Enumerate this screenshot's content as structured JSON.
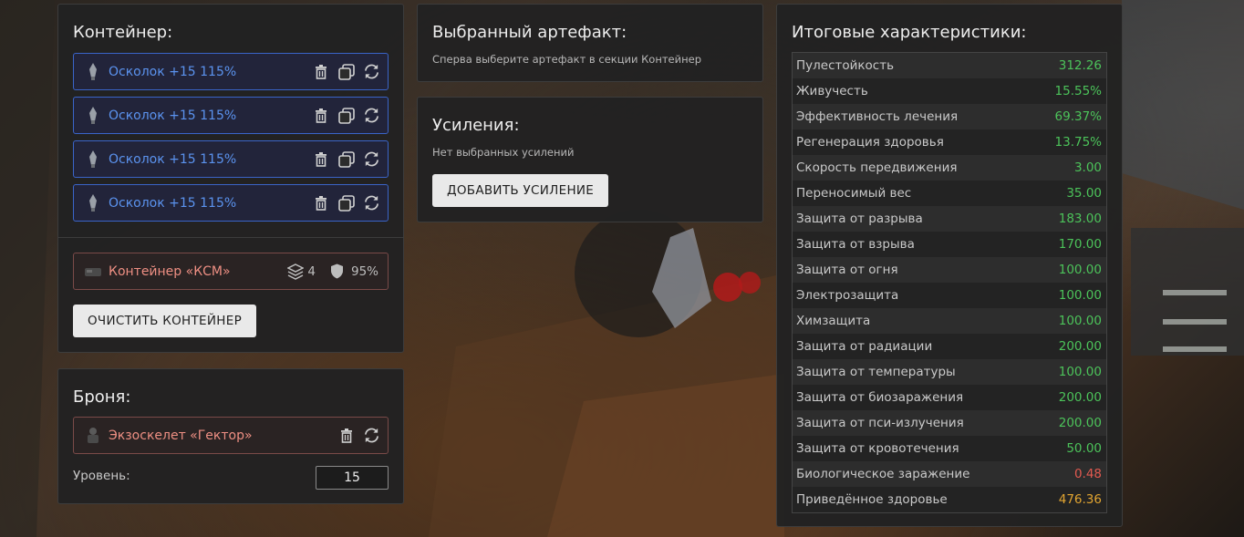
{
  "container_panel": {
    "title": "Контейнер:",
    "artifacts": [
      {
        "label": "Осколок +15 115%"
      },
      {
        "label": "Осколок +15 115%"
      },
      {
        "label": "Осколок +15 115%"
      },
      {
        "label": "Осколок +15 115%"
      }
    ],
    "container": {
      "label": "Контейнер «КСМ»",
      "slots": "4",
      "protection": "95%"
    },
    "clear_button": "ОЧИСТИТЬ КОНТЕЙНЕР"
  },
  "armor_panel": {
    "title": "Броня:",
    "armor": {
      "label": "Экзоскелет «Гектор»"
    },
    "level_label": "Уровень:",
    "level_value": "15"
  },
  "selected_artifact_panel": {
    "title": "Выбранный артефакт:",
    "hint": "Сперва выберите артефакт в секции Контейнер"
  },
  "boosts_panel": {
    "title": "Усиления:",
    "hint": "Нет выбранных усилений",
    "add_button": "ДОБАВИТЬ УСИЛЕНИЕ"
  },
  "totals_panel": {
    "title": "Итоговые характеристики:",
    "stats": [
      {
        "name": "Пулестойкость",
        "value": "312.26"
      },
      {
        "name": "Живучесть",
        "value": "15.55%"
      },
      {
        "name": "Эффективность лечения",
        "value": "69.37%"
      },
      {
        "name": "Регенерация здоровья",
        "value": "13.75%"
      },
      {
        "name": "Скорость передвижения",
        "value": "3.00"
      },
      {
        "name": "Переносимый вес",
        "value": "35.00"
      },
      {
        "name": "Защита от разрыва",
        "value": "183.00"
      },
      {
        "name": "Защита от взрыва",
        "value": "170.00"
      },
      {
        "name": "Защита от огня",
        "value": "100.00"
      },
      {
        "name": "Электрозащита",
        "value": "100.00"
      },
      {
        "name": "Химзащита",
        "value": "100.00"
      },
      {
        "name": "Защита от радиации",
        "value": "200.00"
      },
      {
        "name": "Защита от температуры",
        "value": "100.00"
      },
      {
        "name": "Защита от биозаражения",
        "value": "200.00"
      },
      {
        "name": "Защита от пси-излучения",
        "value": "200.00"
      },
      {
        "name": "Защита от кровотечения",
        "value": "50.00"
      },
      {
        "name": "Биологическое заражение",
        "value": "0.48"
      },
      {
        "name": "Приведённое здоровье",
        "value": "476.36"
      }
    ]
  },
  "colors": {
    "artifact_accent": "#5b93ef",
    "item_red": "#ee8f83",
    "positive": "#4cc35a",
    "negative": "#e35a50",
    "total": "#e2a531"
  }
}
